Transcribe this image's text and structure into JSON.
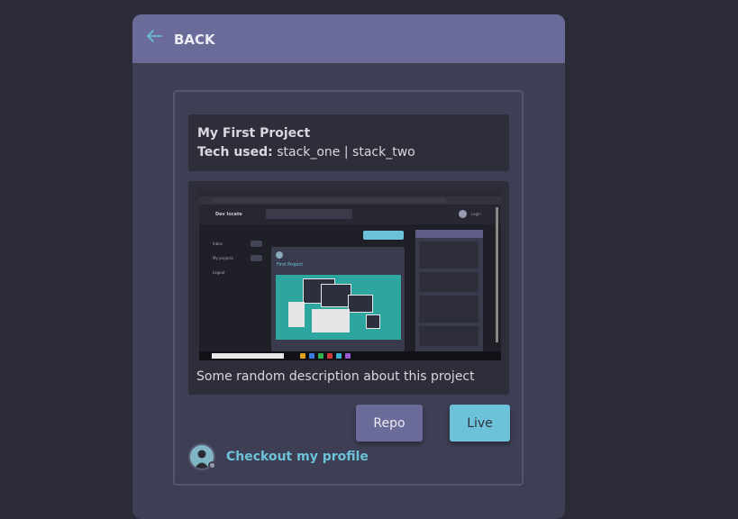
{
  "header": {
    "back_label": "BACK",
    "back_icon": "arrow-left-icon"
  },
  "project": {
    "title": "My First Project",
    "tech_label": "Tech used:",
    "tech_value": "stack_one | stack_two",
    "description": "Some random description about this project"
  },
  "screenshot_content": {
    "brand": "Dev locate",
    "login": "Login",
    "sidebar_items": [
      "Inbox",
      "My projects",
      "Logout"
    ],
    "card_title": "First Project"
  },
  "actions": {
    "repo_label": "Repo",
    "live_label": "Live"
  },
  "profile": {
    "link_text": "Checkout my profile"
  },
  "colors": {
    "background": "#2c2c38",
    "modal": "#3e3e55",
    "header": "#6b6b9a",
    "accent": "#6cc3d9"
  }
}
